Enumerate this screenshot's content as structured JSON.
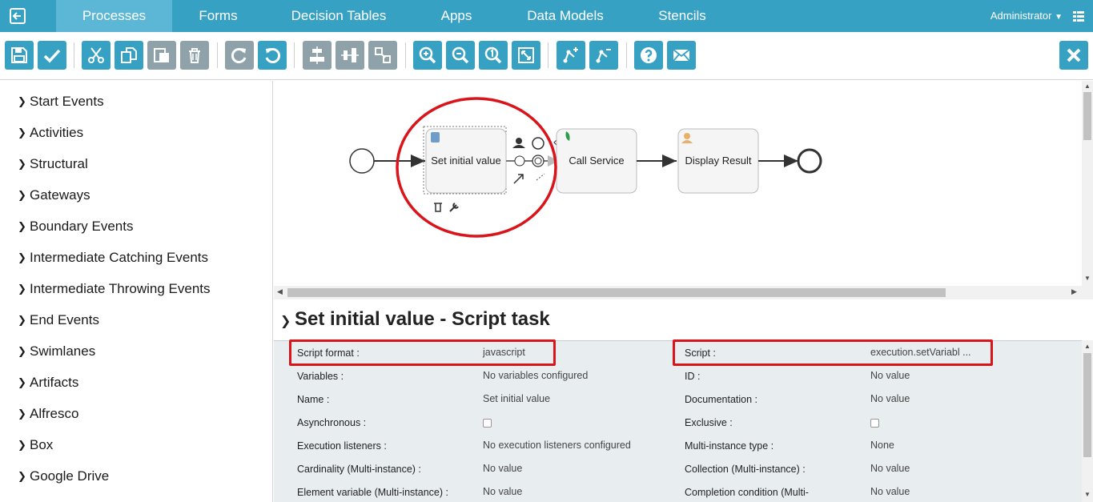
{
  "nav": {
    "tabs": [
      "Processes",
      "Forms",
      "Decision Tables",
      "Apps",
      "Data Models",
      "Stencils"
    ],
    "user": "Administrator"
  },
  "palette": {
    "items": [
      "Start Events",
      "Activities",
      "Structural",
      "Gateways",
      "Boundary Events",
      "Intermediate Catching Events",
      "Intermediate Throwing Events",
      "End Events",
      "Swimlanes",
      "Artifacts",
      "Alfresco",
      "Box",
      "Google Drive"
    ]
  },
  "diagram": {
    "tasks": [
      "Set initial value",
      "Call Service",
      "Display Result"
    ]
  },
  "properties": {
    "title": "Set initial value - Script task",
    "left": [
      {
        "label": "Script format :",
        "value": "javascript"
      },
      {
        "label": "Variables :",
        "value": "No variables configured"
      },
      {
        "label": "Name :",
        "value": "Set initial value"
      },
      {
        "label": "Asynchronous :",
        "value": ""
      },
      {
        "label": "Execution listeners :",
        "value": "No execution listeners configured"
      },
      {
        "label": "Cardinality (Multi-instance) :",
        "value": "No value"
      },
      {
        "label": "Element variable (Multi-instance) :",
        "value": "No value"
      }
    ],
    "right": [
      {
        "label": "Script :",
        "value": "execution.setVariabl ..."
      },
      {
        "label": "ID :",
        "value": "No value"
      },
      {
        "label": "Documentation :",
        "value": "No value"
      },
      {
        "label": "Exclusive :",
        "value": ""
      },
      {
        "label": "Multi-instance type :",
        "value": "None"
      },
      {
        "label": "Collection (Multi-instance) :",
        "value": "No value"
      },
      {
        "label": "Completion condition (Multi-",
        "value": "No value"
      }
    ]
  },
  "colors": {
    "brand": "#37a1c4",
    "highlight": "#d9141b",
    "disabled": "#8fa2a9"
  }
}
